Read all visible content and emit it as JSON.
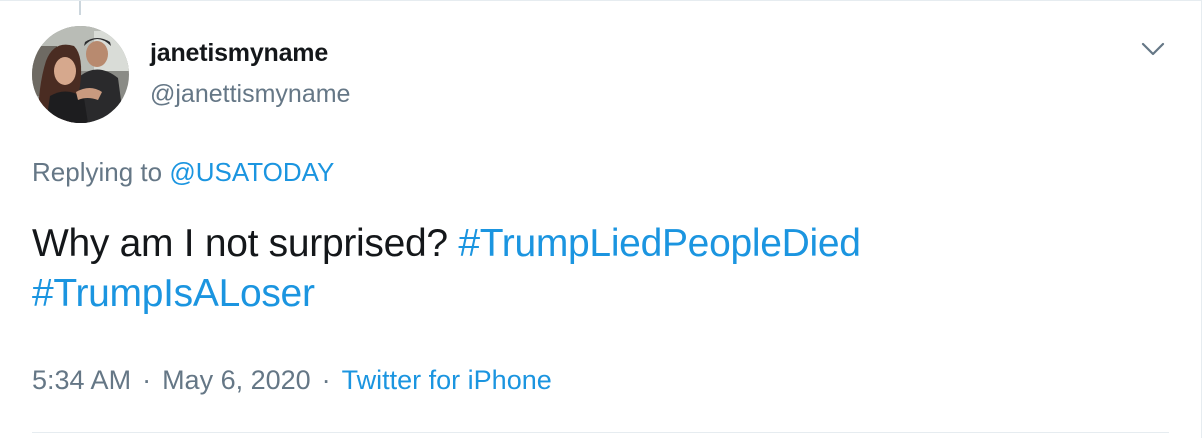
{
  "tweet": {
    "display_name": "janetismyname",
    "handle": "@janettismyname",
    "replying_prefix": "Replying to",
    "replying_to": "@USATODAY",
    "text_plain": "Why am I not surprised?",
    "hashtags": [
      "#TrumpLiedPeopleDied",
      "#TrumpIsALoser"
    ],
    "time": "5:34 AM",
    "separator": "·",
    "date": "May 6, 2020",
    "source": "Twitter for iPhone"
  },
  "icons": {
    "more_menu": "chevron-down-icon",
    "avatar": "avatar"
  },
  "colors": {
    "text": "#14171a",
    "secondary": "#657786",
    "link": "#1b95e0",
    "border": "#e6ecf0"
  }
}
